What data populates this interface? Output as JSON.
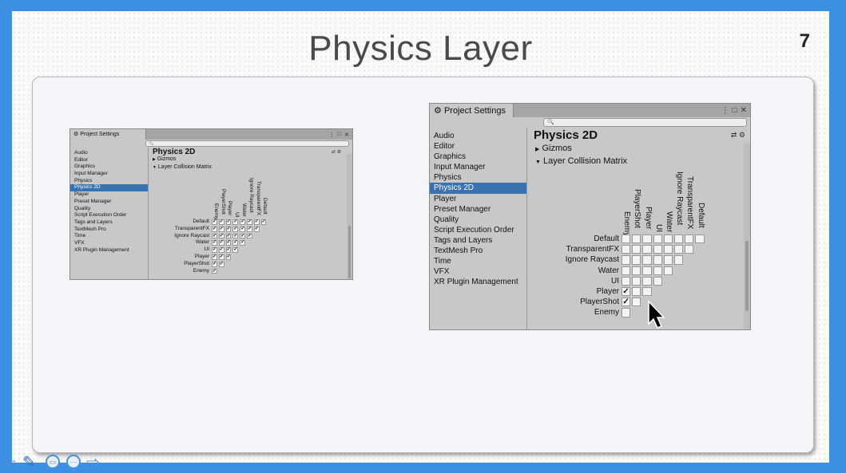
{
  "slide": {
    "title": "Physics Layer",
    "page_number": "7"
  },
  "nav": {
    "prev": "⇦",
    "next": "⇨",
    "pen": "✎"
  },
  "window": {
    "tab_title": "Project Settings",
    "gear_glyph": "⚙",
    "controls": [
      "⋮",
      "□",
      "✕"
    ],
    "search_glyph": "🔍",
    "settings_icons": [
      "⇄",
      "⚙"
    ],
    "sidebar": [
      "Audio",
      "Editor",
      "Graphics",
      "Input Manager",
      "Physics",
      "Physics 2D",
      "Player",
      "Preset Manager",
      "Quality",
      "Script Execution Order",
      "Tags and Layers",
      "TextMesh Pro",
      "Time",
      "VFX",
      "XR Plugin Management"
    ],
    "selected_index": 5,
    "heading": "Physics 2D",
    "gizmos": "Gizmos",
    "matrix_title": "Layer Collision Matrix",
    "fold_closed": "▶",
    "fold_open": "▼",
    "layers": [
      "Default",
      "TransparentFX",
      "Ignore Raycast",
      "Water",
      "UI",
      "Player",
      "PlayerShot",
      "Enemy"
    ],
    "columns": [
      "Enemy",
      "PlayerShot",
      "Player",
      "UI",
      "Water",
      "Ignore Raycast",
      "TransparentFX",
      "Default"
    ],
    "check_glyph": "✓"
  },
  "left_matrix_checks": [
    [
      1,
      1,
      1,
      1,
      1,
      1,
      1,
      1
    ],
    [
      1,
      1,
      1,
      1,
      1,
      1,
      1
    ],
    [
      1,
      1,
      1,
      1,
      1,
      1
    ],
    [
      1,
      1,
      1,
      1,
      1
    ],
    [
      1,
      1,
      1,
      1
    ],
    [
      1,
      1,
      1
    ],
    [
      1,
      1
    ],
    [
      1
    ]
  ],
  "right_matrix_checks": [
    [
      0,
      0,
      0,
      0,
      0,
      0,
      0,
      0
    ],
    [
      0,
      0,
      0,
      0,
      0,
      0,
      0
    ],
    [
      0,
      0,
      0,
      0,
      0,
      0
    ],
    [
      0,
      0,
      0,
      0,
      0
    ],
    [
      0,
      0,
      0,
      0
    ],
    [
      1,
      0,
      0
    ],
    [
      1,
      0
    ],
    [
      0
    ]
  ]
}
